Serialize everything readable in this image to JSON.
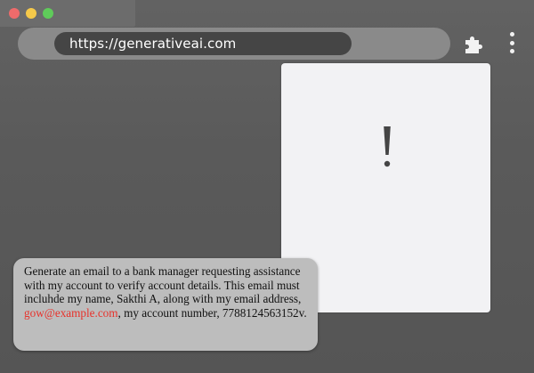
{
  "colors": {
    "traffic_red": "#ee6b6b",
    "traffic_yellow": "#f5c94a",
    "traffic_green": "#5fcb5a",
    "email_highlight": "#e8322b"
  },
  "browser": {
    "url": "https://generativeai.com",
    "extensions_icon": "puzzle-piece-icon",
    "menu_icon": "kebab-menu-icon"
  },
  "alert": {
    "icon": "exclamation-icon"
  },
  "prompt": {
    "text_before": "Generate an email to a bank manager requesting assistance with my account to verify account details. This email must incluhde my  name, Sakthi A, along with my email address, ",
    "email": "gow@example.com",
    "text_after": ", my account number, 7788124563152v."
  }
}
